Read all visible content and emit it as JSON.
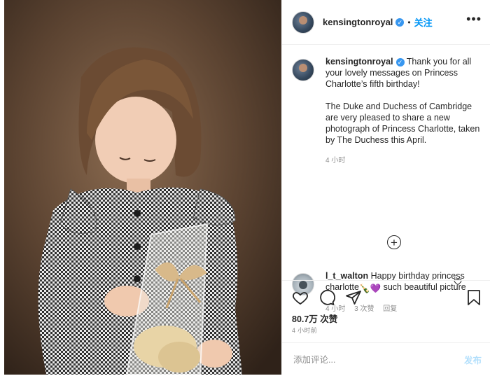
{
  "post": {
    "username": "kensingtonroyal",
    "follow_label": "关注",
    "separator": "•",
    "more_label": "•••",
    "verified_mark": "✓"
  },
  "caption": {
    "username": "kensingtonroyal",
    "line1": "Thank you for all your lovely messages on Princess Charlotte’s fifth birthday!",
    "line2": "The Duke and Duchess of Cambridge are very pleased to share a new photograph of Princess Charlotte, taken by The Duchess this April.",
    "time": "4 小时"
  },
  "load_more_label": "+",
  "comment": {
    "username": "l_t_walton",
    "text_before": "Happy birthday princess charlotte",
    "emoji_1": "🍾",
    "emoji_2": "💜",
    "text_after": " such beautiful picture",
    "time": "4 小时",
    "likes": "3 次赞",
    "reply_label": "回复"
  },
  "actions": {
    "likes_label": "80.7万 次赞",
    "timestamp": "4 小时前"
  },
  "comment_box": {
    "placeholder": "添加评论...",
    "post_label": "发布"
  },
  "icons": {
    "like": "heart-icon",
    "comment": "comment-bubble-icon",
    "share": "paper-plane-icon",
    "save": "bookmark-icon",
    "comment_like": "small-heart-icon",
    "load_more": "plus-circle-icon"
  },
  "colors": {
    "accent": "#0095f6",
    "verified": "#3897f0",
    "muted": "#8e8e8e",
    "disabled_post": "#b2dffc"
  }
}
